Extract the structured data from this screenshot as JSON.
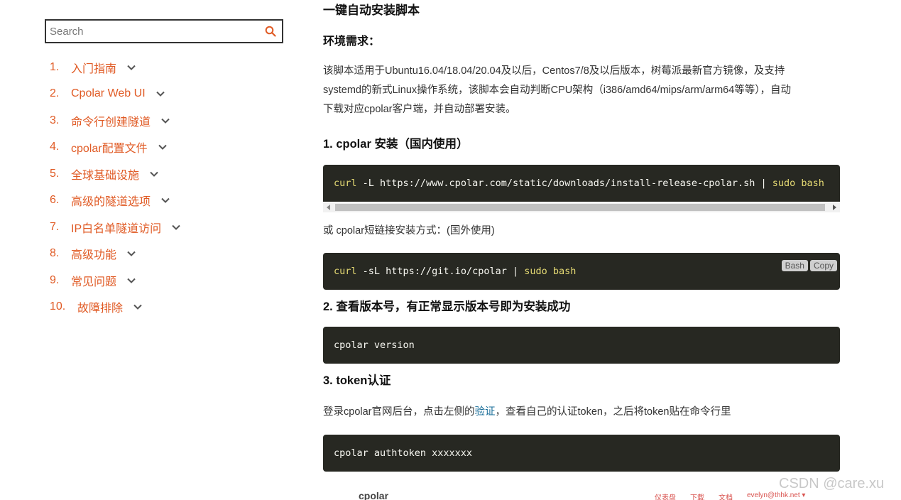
{
  "sidebar": {
    "search": {
      "placeholder": "Search",
      "icon": "search-icon"
    },
    "nav": [
      {
        "num": "1.",
        "label": "入门指南"
      },
      {
        "num": "2.",
        "label": "Cpolar Web UI"
      },
      {
        "num": "3.",
        "label": "命令行创建隧道"
      },
      {
        "num": "4.",
        "label": "cpolar配置文件"
      },
      {
        "num": "5.",
        "label": "全球基础设施"
      },
      {
        "num": "6.",
        "label": "高级的隧道选项"
      },
      {
        "num": "7.",
        "label": "IP白名单隧道访问"
      },
      {
        "num": "8.",
        "label": "高级功能"
      },
      {
        "num": "9.",
        "label": "常见问题"
      },
      {
        "num": "10.",
        "label": "故障排除"
      }
    ],
    "accent_color": "#e05a24"
  },
  "content": {
    "top_heading": "一键自动安装脚本",
    "env_heading": "环境需求：",
    "env_line1": "该脚本适用于Ubuntu16.04/18.04/20.04及以后，Centos7/8及以后版本，树莓派最新官方镜像，及支持",
    "env_line2": "systemd的新式Linux操作系统，该脚本会自动判断CPU架构（i386/amd64/mips/arm/arm64等等），自动",
    "env_line3": "下载对应cpolar客户端，并自动部署安装。",
    "step1_heading": "1. cpolar 安装（国内使用）",
    "code1": {
      "cmd": "curl",
      "args": " -L https://www.cpolar.com/static/downloads/install-release-cpolar.sh | ",
      "pipe_cmd": "sudo bash"
    },
    "alt_note": "或 cpolar短链接安装方式：(国外使用)",
    "code2": {
      "cmd": "curl",
      "args": " -sL https://git.io/cpolar | ",
      "pipe_cmd": "sudo bash",
      "badge_lang": "Bash",
      "badge_copy": "Copy"
    },
    "step2_heading": "2. 查看版本号，有正常显示版本号即为安装成功",
    "code3": "cpolar version",
    "step3_heading": "3. token认证",
    "token_note_pre": "登录cpolar官网后台，点击左侧的",
    "token_note_link": "验证",
    "token_note_post": "，查看自己的认证token，之后将token贴在命令行里",
    "code4": "cpolar authtoken xxxxxxx",
    "code_bg": "#272822",
    "code_keyword_color": "#e6db74"
  },
  "footer": {
    "logo": "cpolar",
    "links": [
      "仪表盘",
      "下载",
      "文档",
      "evelyn@thhk.net ▾"
    ],
    "watermark": "CSDN @care.xu"
  }
}
